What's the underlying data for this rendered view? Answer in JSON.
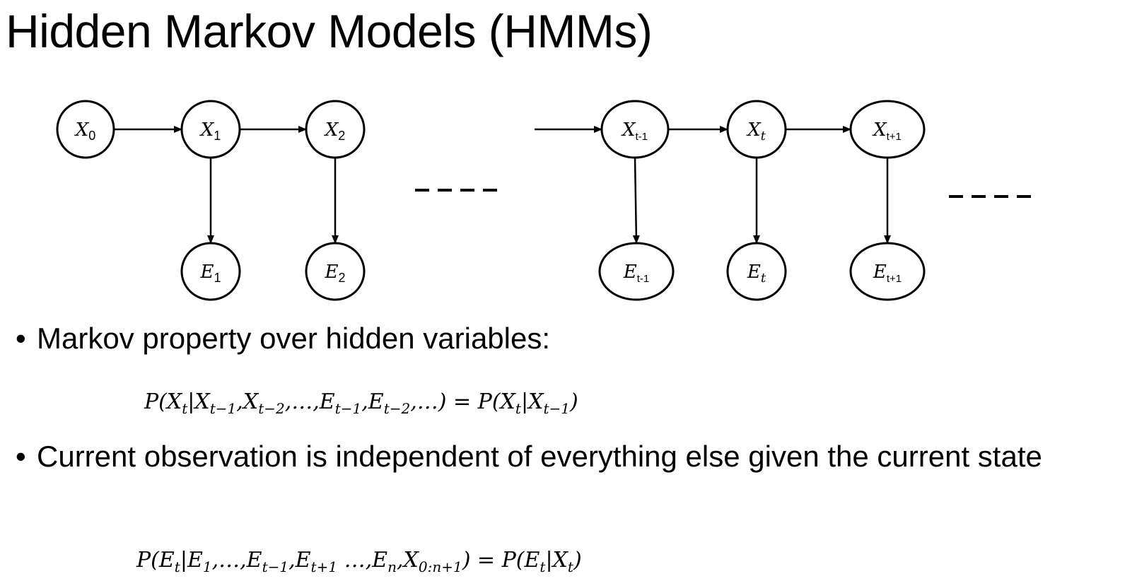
{
  "slide": {
    "title": "Hidden Markov Models (HMMs)"
  },
  "diagram": {
    "hidden_nodes": [
      {
        "id": "x0",
        "base": "X",
        "sub": "0"
      },
      {
        "id": "x1",
        "base": "X",
        "sub": "1"
      },
      {
        "id": "x2",
        "base": "X",
        "sub": "2"
      },
      {
        "id": "xtm1",
        "base": "X",
        "sub": "t-1"
      },
      {
        "id": "xt",
        "base": "X",
        "sub": "t"
      },
      {
        "id": "xtp1",
        "base": "X",
        "sub": "t+1"
      }
    ],
    "evidence_nodes": [
      {
        "id": "e1",
        "base": "E",
        "sub": "1"
      },
      {
        "id": "e2",
        "base": "E",
        "sub": "2"
      },
      {
        "id": "etm1",
        "base": "E",
        "sub": "t-1"
      },
      {
        "id": "et",
        "base": "E",
        "sub": "t"
      },
      {
        "id": "etp1",
        "base": "E",
        "sub": "t+1"
      }
    ],
    "transitions": [
      [
        "x0",
        "x1"
      ],
      [
        "x1",
        "x2"
      ],
      [
        "in",
        "xtm1"
      ],
      [
        "xtm1",
        "xt"
      ],
      [
        "xt",
        "xtp1"
      ]
    ],
    "emissions": [
      [
        "x1",
        "e1"
      ],
      [
        "x2",
        "e2"
      ],
      [
        "xtm1",
        "etm1"
      ],
      [
        "xt",
        "et"
      ],
      [
        "xtp1",
        "etp1"
      ]
    ]
  },
  "bullets": [
    {
      "text": "Markov property over hidden variables:",
      "formula": "P(X_t|X_{t−1},X_{t−2},…,E_{t−1},E_{t−2},…) = P(X_t|X_{t−1})"
    },
    {
      "text": "Current observation is independent of everything else given the current state",
      "formula": "P(E_t|E_1,…,E_{t−1},E_{t+1} …,E_n,X_{0:n+1}) = P(E_t|X_t)"
    }
  ]
}
